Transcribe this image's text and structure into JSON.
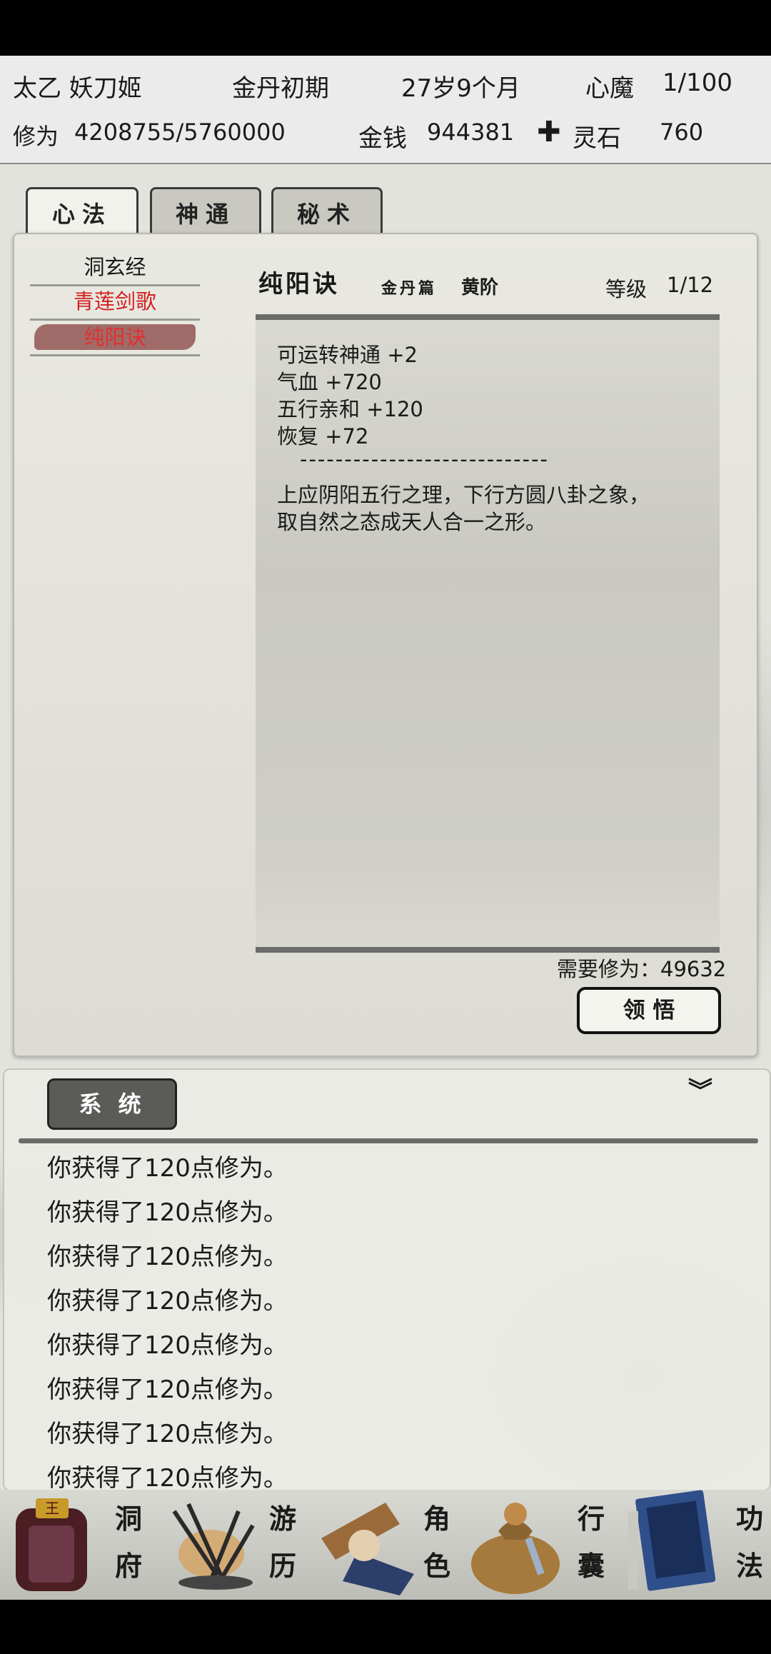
{
  "status": {
    "name": "太乙 妖刀姬",
    "realm": "金丹初期",
    "age": "27岁9个月",
    "xinmo_label": "心魔",
    "xinmo_value": "1/100",
    "xiuwei_label": "修为",
    "xiuwei_value": "4208755/5760000",
    "money_label": "金钱",
    "money_value": "944381",
    "lingshi_label": "灵石",
    "lingshi_value": "760"
  },
  "tabs": [
    "心法",
    "神通",
    "秘术"
  ],
  "technique_list": [
    {
      "label": "洞玄经",
      "color": "#222222"
    },
    {
      "label": "青莲剑歌",
      "color": "#d42020"
    },
    {
      "label": "纯阳诀",
      "color": "#e03030",
      "selected": true
    }
  ],
  "detail": {
    "title": "纯阳诀",
    "subtitle_a": "金丹篇",
    "subtitle_b": "黄阶",
    "level_label": "等级",
    "level_value": "1/12",
    "effects": [
      "可运转神通 +2",
      "气血 +720",
      "五行亲和 +120",
      "恢复 +72"
    ],
    "divider": "----------------------------",
    "description_lines": [
      "上应阴阳五行之理，下行方圆八卦之象，",
      "取自然之态成天人合一之形。"
    ],
    "required_label": "需要修为：49632",
    "learn_button": "领 悟"
  },
  "system": {
    "tab_label": "系 统",
    "log": [
      "你获得了120点修为。",
      "你获得了120点修为。",
      "你获得了120点修为。",
      "你获得了120点修为。",
      "你获得了120点修为。",
      "你获得了120点修为。",
      "你获得了120点修为。",
      "你获得了120点修为。"
    ]
  },
  "nav": [
    {
      "l1": "洞",
      "l2": "府",
      "icon": "cave-icon"
    },
    {
      "l1": "游",
      "l2": "历",
      "icon": "travel-icon"
    },
    {
      "l1": "角",
      "l2": "色",
      "icon": "character-icon"
    },
    {
      "l1": "行",
      "l2": "囊",
      "icon": "bag-icon"
    },
    {
      "l1": "功",
      "l2": "法",
      "icon": "book-icon"
    }
  ],
  "colors": {
    "selected_red": "#e03030",
    "ink": "#1a1a1a"
  }
}
